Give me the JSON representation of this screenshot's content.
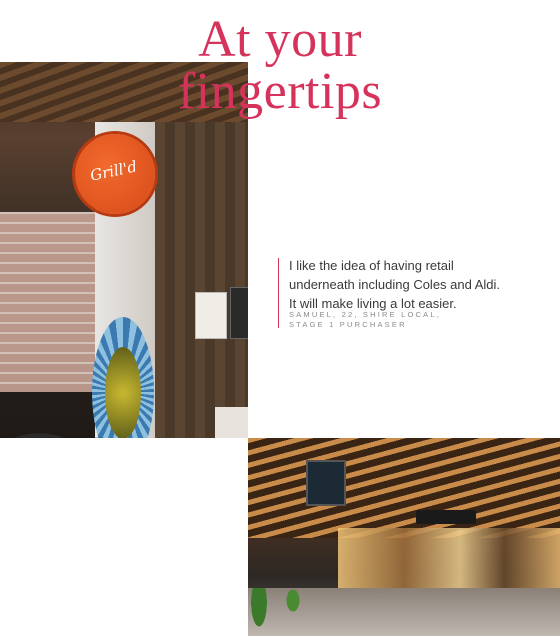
{
  "title": {
    "line1": "At your",
    "line2": "fingertips"
  },
  "quote": {
    "lines": [
      "I like the idea of having retail",
      "underneath including Coles and Aldi.",
      "It will make living a lot easier."
    ]
  },
  "attribution": {
    "line1": "SAMUEL, 22, SHIRE LOCAL,",
    "line2": "STAGE 1 PURCHASER"
  },
  "photo1": {
    "sign_text": "Grill'd"
  },
  "colors": {
    "accent": "#d6335c",
    "body_text": "#3a3a3a",
    "caption_text": "#8a8a8a"
  }
}
